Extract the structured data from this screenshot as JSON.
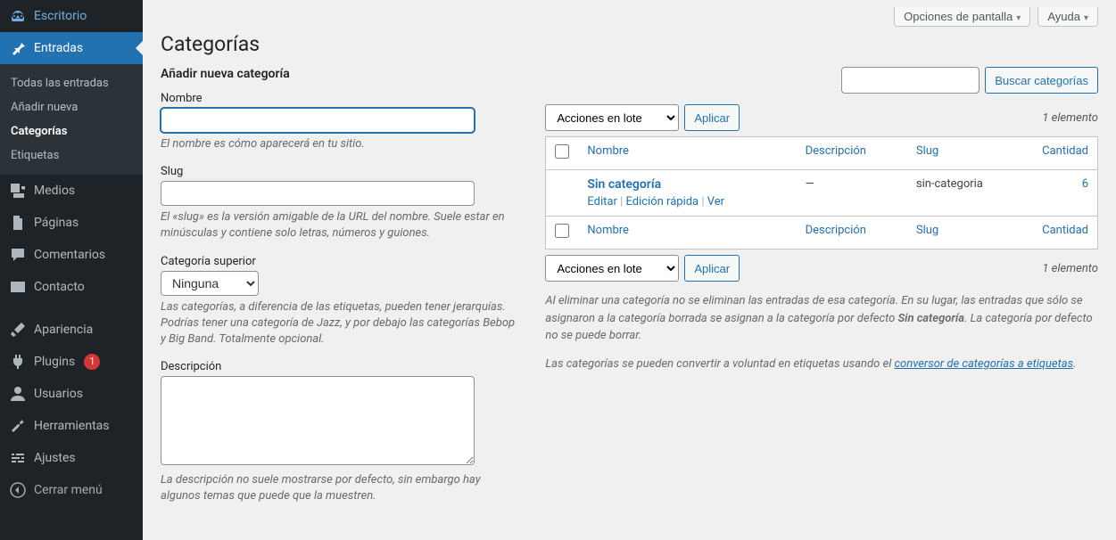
{
  "topbar": {
    "screen_options": "Opciones de pantalla",
    "help": "Ayuda"
  },
  "sidebar": {
    "items": [
      {
        "name": "dashboard",
        "label": "Escritorio",
        "icon": "🏠"
      },
      {
        "name": "posts",
        "label": "Entradas",
        "icon": "📌",
        "active": true
      },
      {
        "name": "media",
        "label": "Medios",
        "icon": "🖼"
      },
      {
        "name": "pages",
        "label": "Páginas",
        "icon": "📄"
      },
      {
        "name": "comments",
        "label": "Comentarios",
        "icon": "💬"
      },
      {
        "name": "contact",
        "label": "Contacto",
        "icon": "✉"
      },
      {
        "name": "appearance",
        "label": "Apariencia",
        "icon": "🖌"
      },
      {
        "name": "plugins",
        "label": "Plugins",
        "icon": "🔌",
        "badge": "1"
      },
      {
        "name": "users",
        "label": "Usuarios",
        "icon": "👤"
      },
      {
        "name": "tools",
        "label": "Herramientas",
        "icon": "🔧"
      },
      {
        "name": "settings",
        "label": "Ajustes",
        "icon": "⚙"
      },
      {
        "name": "collapse",
        "label": "Cerrar menú",
        "icon": "◀"
      }
    ],
    "submenu": [
      {
        "label": "Todas las entradas",
        "current": false
      },
      {
        "label": "Añadir nueva",
        "current": false
      },
      {
        "label": "Categorías",
        "current": true
      },
      {
        "label": "Etiquetas",
        "current": false
      }
    ]
  },
  "page": {
    "title": "Categorías"
  },
  "form": {
    "heading": "Añadir nueva categoría",
    "name_label": "Nombre",
    "name_help": "El nombre es cómo aparecerá en tu sitio.",
    "slug_label": "Slug",
    "slug_help": "El «slug» es la versión amigable de la URL del nombre. Suele estar en minúsculas y contiene solo letras, números y guiones.",
    "parent_label": "Categoría superior",
    "parent_value": "Ninguna",
    "parent_help": "Las categorías, a diferencia de las etiquetas, pueden tener jerarquías. Podrías tener una categoría de Jazz, y por debajo las categorías Bebop y Big Band. Totalmente opcional.",
    "desc_label": "Descripción",
    "desc_help": "La descripción no suele mostrarse por defecto, sin embargo hay algunos temas que puede que la muestren."
  },
  "search": {
    "button": "Buscar categorías"
  },
  "bulk": {
    "label": "Acciones en lote",
    "apply": "Aplicar"
  },
  "count_text": "1 elemento",
  "table": {
    "cols": {
      "name": "Nombre",
      "desc": "Descripción",
      "slug": "Slug",
      "qty": "Cantidad"
    },
    "rows": [
      {
        "name": "Sin categoría",
        "desc": "—",
        "slug": "sin-categoria",
        "qty": "6"
      }
    ],
    "actions": {
      "edit": "Editar",
      "quick": "Edición rápida",
      "view": "Ver"
    }
  },
  "notes": {
    "p1a": "Al eliminar una categoría no se eliminan las entradas de esa categoría. En su lugar, las entradas que sólo se asignaron a la categoría borrada se asignan a la categoría por defecto ",
    "p1b": "Sin categoría",
    "p1c": ". La categoría por defecto no se puede borrar.",
    "p2a": "Las categorías se pueden convertir a voluntad en etiquetas usando el ",
    "p2link": "conversor de categorías a etiquetas",
    "p2b": "."
  }
}
